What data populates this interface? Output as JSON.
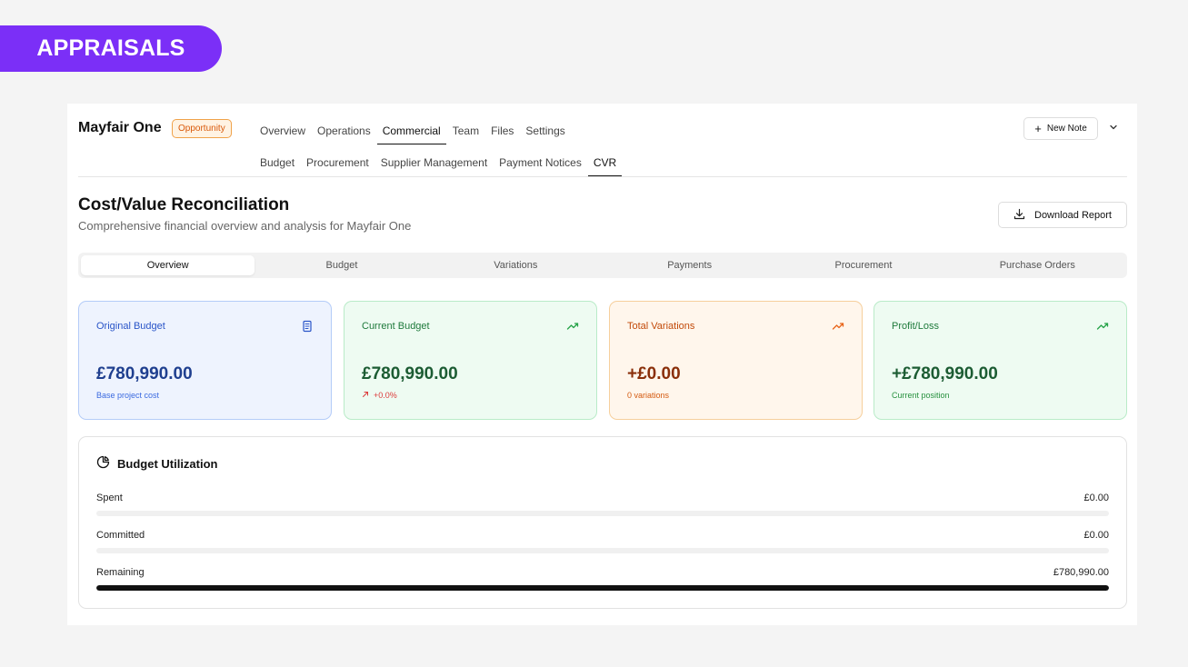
{
  "banner": {
    "label": "APPRAISALS"
  },
  "project": {
    "name": "Mayfair One",
    "badge": "Opportunity"
  },
  "nav_primary": [
    {
      "label": "Overview",
      "active": false
    },
    {
      "label": "Operations",
      "active": false
    },
    {
      "label": "Commercial",
      "active": true
    },
    {
      "label": "Team",
      "active": false
    },
    {
      "label": "Files",
      "active": false
    },
    {
      "label": "Settings",
      "active": false
    }
  ],
  "nav_secondary": [
    {
      "label": "Budget",
      "active": false
    },
    {
      "label": "Procurement",
      "active": false
    },
    {
      "label": "Supplier Management",
      "active": false
    },
    {
      "label": "Payment Notices",
      "active": false
    },
    {
      "label": "CVR",
      "active": true
    }
  ],
  "actions": {
    "new_note": "New Note",
    "download": "Download Report"
  },
  "page": {
    "title": "Cost/Value Reconciliation",
    "subtitle": "Comprehensive financial overview and analysis for Mayfair One"
  },
  "tabs": [
    {
      "label": "Overview",
      "active": true
    },
    {
      "label": "Budget",
      "active": false
    },
    {
      "label": "Variations",
      "active": false
    },
    {
      "label": "Payments",
      "active": false
    },
    {
      "label": "Procurement",
      "active": false
    },
    {
      "label": "Purchase Orders",
      "active": false
    }
  ],
  "cards": [
    {
      "label": "Original Budget",
      "value": "£780,990.00",
      "note": "Base project cost",
      "icon": "document-icon",
      "color": "#2a55c8"
    },
    {
      "label": "Current Budget",
      "value": "£780,990.00",
      "note": "+0.0%",
      "icon": "trending-up-icon",
      "color": "#1f7a3c"
    },
    {
      "label": "Total Variations",
      "value": "+£0.00",
      "note": "0 variations",
      "icon": "trending-up-icon",
      "color": "#c24a0a"
    },
    {
      "label": "Profit/Loss",
      "value": "+£780,990.00",
      "note": "Current position",
      "icon": "trending-up-icon",
      "color": "#1f7a3c"
    }
  ],
  "utilization": {
    "title": "Budget Utilization",
    "icon": "pie-chart-icon",
    "rows": [
      {
        "label": "Spent",
        "value": "£0.00",
        "percent": 0
      },
      {
        "label": "Committed",
        "value": "£0.00",
        "percent": 0
      },
      {
        "label": "Remaining",
        "value": "£780,990.00",
        "percent": 100
      }
    ]
  }
}
